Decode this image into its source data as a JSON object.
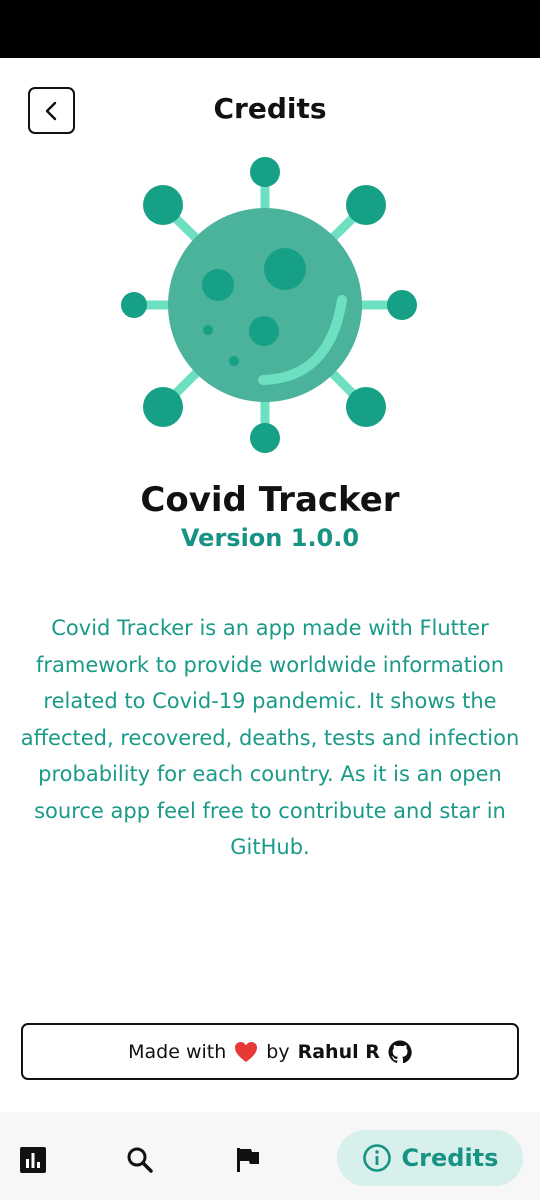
{
  "header": {
    "title": "Credits",
    "back_icon": "chevron-left-icon"
  },
  "app": {
    "name": "Covid Tracker",
    "version": "Version 1.0.0",
    "description": "Covid Tracker is an app made with Flutter framework to provide worldwide information related to Covid-19 pandemic. It shows the affected, recovered, deaths, tests and infection probability for each country. As it is an open source app feel free to contribute and star in GitHub.",
    "logo_icon": "virus-icon"
  },
  "footer": {
    "made_with": "Made with",
    "by": "by",
    "author": "Rahul R",
    "heart_icon": "heart-icon",
    "github_icon": "github-icon"
  },
  "bottom_nav": {
    "items": [
      {
        "icon": "bar-chart-icon"
      },
      {
        "icon": "search-icon"
      },
      {
        "icon": "flag-icon"
      },
      {
        "icon": "info-icon",
        "label": "Credits",
        "active": true
      }
    ]
  },
  "colors": {
    "accent": "#179383",
    "virus_body": "#4bb39c",
    "virus_dark": "#16a085",
    "virus_light": "#6ce0c0",
    "heart": "#e53935",
    "active_tab_bg": "#d8f0ec"
  }
}
